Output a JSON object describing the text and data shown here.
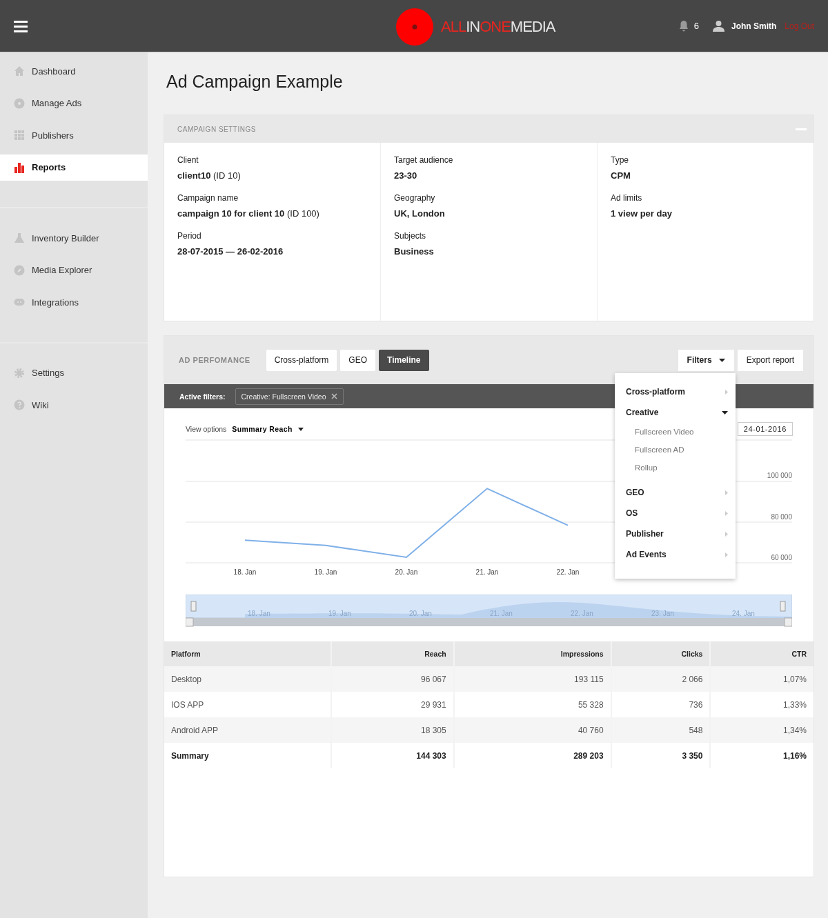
{
  "header": {
    "logo": [
      {
        "text": "ALL",
        "color": "#e8251f"
      },
      {
        "text": "IN",
        "color": "#e6e6e6"
      },
      {
        "text": "ONE",
        "color": "#e8251f"
      },
      {
        "text": "MEDIA",
        "color": "#e6e6e6"
      }
    ],
    "notifications": "6",
    "user": "John Smith",
    "logout": "Log Out"
  },
  "sidebar": {
    "groups": [
      [
        {
          "label": "Dashboard",
          "selected": false
        },
        {
          "label": "Manage Ads",
          "selected": false
        },
        {
          "label": "Publishers",
          "selected": false
        },
        {
          "label": "Reports",
          "selected": true
        }
      ],
      [
        {
          "label": "Inventory Builder",
          "selected": false
        },
        {
          "label": "Media Explorer",
          "selected": false
        },
        {
          "label": "Integrations",
          "selected": false
        }
      ],
      [
        {
          "label": "Settings",
          "selected": false
        },
        {
          "label": "Wiki",
          "selected": false
        }
      ]
    ]
  },
  "page_title": "Ad Campaign Example",
  "campaign_settings": {
    "title": "CAMPAIGN SETTINGS",
    "columns": [
      [
        {
          "label": "Client",
          "value": "**client10** (ID 10)"
        },
        {
          "label": "Campaign name",
          "value": "**campaign 10 for client 10** (ID 100)"
        },
        {
          "label": "Period",
          "value": "**28-07-2015 — 26-02-2016**"
        }
      ],
      [
        {
          "label": "Target audience",
          "value": "**23-30**"
        },
        {
          "label": "Geography",
          "value": "**UK, London**"
        },
        {
          "label": "Subjects",
          "value": "**Business**"
        }
      ],
      [
        {
          "label": "Type",
          "value": "**CPM**"
        },
        {
          "label": "Ad limits",
          "value": "**1 view per day**"
        }
      ]
    ]
  },
  "ad_performance": {
    "title": "AD PERFOMANCE",
    "tabs": [
      {
        "label": "Cross-platform",
        "selected": false
      },
      {
        "label": "GEO",
        "selected": false
      },
      {
        "label": "Timeline",
        "selected": true
      }
    ],
    "filters_button": "Filters",
    "export_button": "Export report",
    "active_filters": {
      "label": "Active filters:",
      "chips": [
        "Creative: Fullscreen Video"
      ]
    },
    "view_options": {
      "label": "View options",
      "value": "Summary Reach"
    },
    "date": "24-01-2016",
    "chart_data": {
      "type": "line",
      "categories": [
        "18. Jan",
        "19. Jan",
        "20. Jan",
        "21. Jan",
        "22. Jan"
      ],
      "series": [
        {
          "color": "#7fb0e8",
          "values": [
            71000,
            68500,
            62700,
            96300,
            78300
          ]
        }
      ],
      "ylim": [
        60000,
        120000
      ],
      "yticks": [
        {
          "value": 60000,
          "label": "60 000"
        },
        {
          "value": 80000,
          "label": "80 000"
        },
        {
          "value": 100000,
          "label": "100 000"
        }
      ]
    },
    "navigator": {
      "labels": [
        "18. Jan",
        "19. Jan",
        "20. Jan",
        "21. Jan",
        "22. Jan",
        "23. Jan",
        "24. Jan"
      ]
    },
    "filter_menu": [
      {
        "label": "Cross-platform",
        "expanded": false
      },
      {
        "label": "Creative",
        "expanded": true,
        "children": [
          {
            "label": "Fullscreen Video"
          },
          {
            "label": "Fullscreen AD"
          },
          {
            "label": "Rollup"
          }
        ]
      },
      {
        "label": "GEO",
        "expanded": false
      },
      {
        "label": "OS",
        "expanded": false
      },
      {
        "label": "Publisher",
        "expanded": false
      },
      {
        "label": "Ad Events",
        "expanded": false
      }
    ],
    "table": {
      "columns": [
        "Platform",
        "Reach",
        "Impressions",
        "Clicks",
        "CTR"
      ],
      "rows": [
        {
          "kind": "data",
          "cells": [
            "Desktop",
            "96 067",
            "193 115",
            "2 066",
            "1,07%"
          ]
        },
        {
          "kind": "data",
          "cells": [
            "IOS APP",
            "29 931",
            "55 328",
            "736",
            "1,33%"
          ]
        },
        {
          "kind": "data",
          "cells": [
            "Android APP",
            "18 305",
            "40 760",
            "548",
            "1,34%"
          ]
        },
        {
          "kind": "summary",
          "cells": [
            "Summary",
            "144 303",
            "289 203",
            "3 350",
            "1,16%"
          ]
        }
      ]
    }
  }
}
